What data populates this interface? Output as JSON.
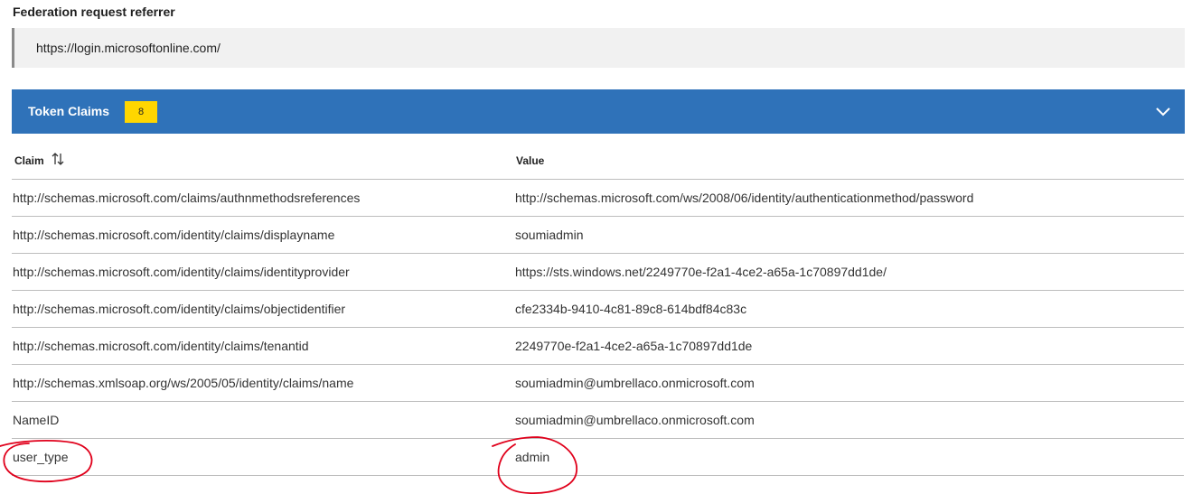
{
  "federation": {
    "label": "Federation request referrer",
    "value": "https://login.microsoftonline.com/"
  },
  "token_claims": {
    "title": "Token Claims",
    "count": "8",
    "icon": "chevron-down-icon",
    "header_color": "#2f72b9",
    "badge_color": "#ffd600"
  },
  "table": {
    "columns": {
      "claim": "Claim",
      "value": "Value"
    },
    "sort_icon": "sort-arrows-icon",
    "rows": [
      {
        "claim": "http://schemas.microsoft.com/claims/authnmethodsreferences",
        "value": "http://schemas.microsoft.com/ws/2008/06/identity/authenticationmethod/password"
      },
      {
        "claim": "http://schemas.microsoft.com/identity/claims/displayname",
        "value": "soumiadmin"
      },
      {
        "claim": "http://schemas.microsoft.com/identity/claims/identityprovider",
        "value": "https://sts.windows.net/2249770e-f2a1-4ce2-a65a-1c70897dd1de/"
      },
      {
        "claim": "http://schemas.microsoft.com/identity/claims/objectidentifier",
        "value": "cfe2334b-9410-4c81-89c8-614bdf84c83c"
      },
      {
        "claim": "http://schemas.microsoft.com/identity/claims/tenantid",
        "value": "2249770e-f2a1-4ce2-a65a-1c70897dd1de"
      },
      {
        "claim": "http://schemas.xmlsoap.org/ws/2005/05/identity/claims/name",
        "value": "soumiadmin@umbrellaco.onmicrosoft.com"
      },
      {
        "claim": "NameID",
        "value": "soumiadmin@umbrellaco.onmicrosoft.com"
      },
      {
        "claim": "user_type",
        "value": "admin"
      }
    ]
  },
  "annotation_color": "#e0001b"
}
